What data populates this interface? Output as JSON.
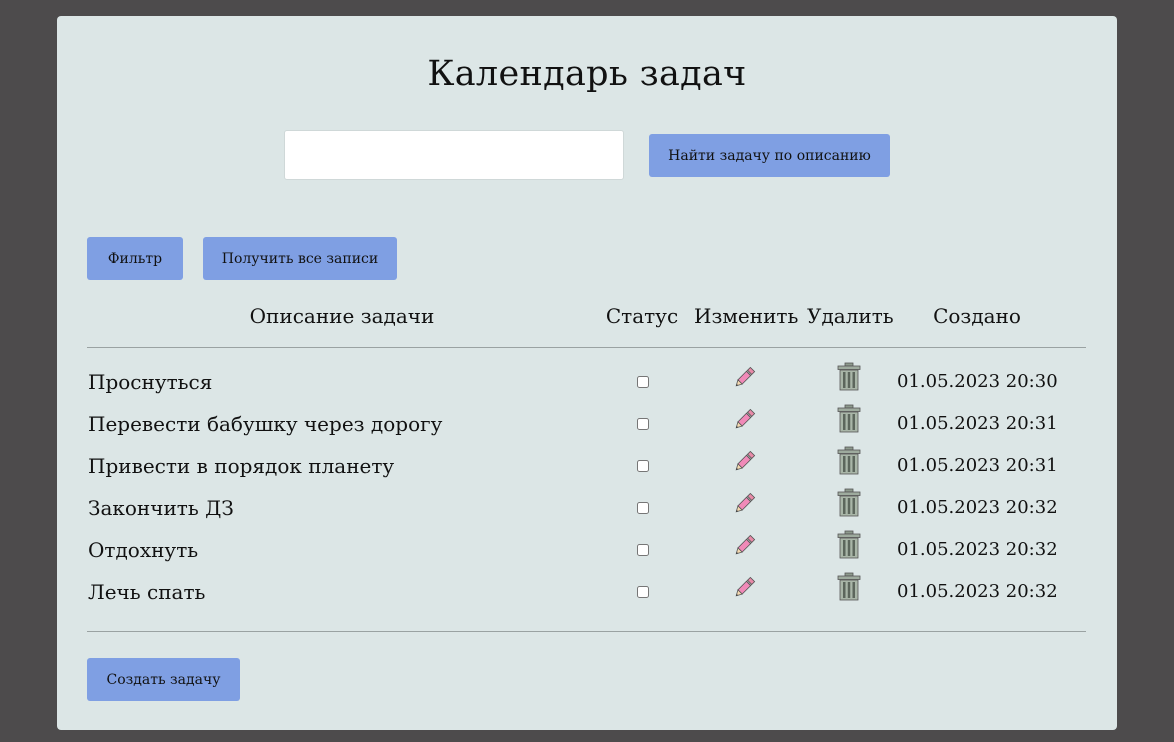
{
  "header": {
    "title": "Календарь задач"
  },
  "search": {
    "value": "",
    "placeholder": "",
    "button_label": "Найти задачу по описанию"
  },
  "toolbar": {
    "filter_label": "Фильтр",
    "get_all_label": "Получить все записи"
  },
  "table": {
    "columns": [
      "Описание задачи",
      "Статус",
      "Изменить",
      "Удалить",
      "Создано"
    ],
    "rows": [
      {
        "description": "Проснуться",
        "done": false,
        "created": "01.05.2023 20:30"
      },
      {
        "description": "Перевести бабушку через дорогу",
        "done": false,
        "created": "01.05.2023 20:31"
      },
      {
        "description": "Привести в порядок планету",
        "done": false,
        "created": "01.05.2023 20:31"
      },
      {
        "description": "Закончить ДЗ",
        "done": false,
        "created": "01.05.2023 20:32"
      },
      {
        "description": "Отдохнуть",
        "done": false,
        "created": "01.05.2023 20:32"
      },
      {
        "description": "Лечь спать",
        "done": false,
        "created": "01.05.2023 20:32"
      }
    ],
    "edit_icon": "pencil-icon",
    "delete_icon": "trash-icon"
  },
  "footer": {
    "create_label": "Создать задачу"
  },
  "colors": {
    "background": "#4d4b4c",
    "card": "#dce6e6",
    "button": "#7f9fe3"
  }
}
